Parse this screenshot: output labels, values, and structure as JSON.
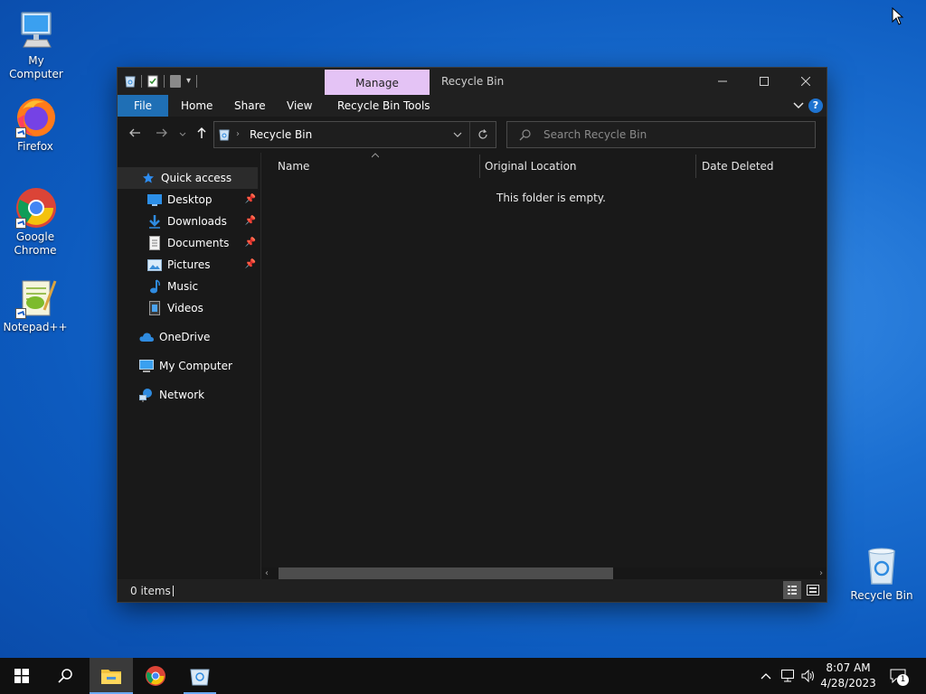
{
  "desktop": {
    "icons": [
      {
        "label": "My Computer"
      },
      {
        "label": "Firefox"
      },
      {
        "label": "Google Chrome"
      },
      {
        "label": "Notepad++"
      },
      {
        "label": "Recycle Bin"
      }
    ]
  },
  "window": {
    "manage_tab": "Manage",
    "title": "Recycle Bin",
    "ribbon": {
      "tabs": [
        "File",
        "Home",
        "Share",
        "View",
        "Recycle Bin Tools"
      ]
    },
    "address": {
      "crumb": "Recycle Bin"
    },
    "search": {
      "placeholder": "Search Recycle Bin"
    },
    "nav": {
      "items": [
        {
          "label": "Quick access"
        },
        {
          "label": "Desktop"
        },
        {
          "label": "Downloads"
        },
        {
          "label": "Documents"
        },
        {
          "label": "Pictures"
        },
        {
          "label": "Music"
        },
        {
          "label": "Videos"
        },
        {
          "label": "OneDrive"
        },
        {
          "label": "My Computer"
        },
        {
          "label": "Network"
        }
      ]
    },
    "columns": [
      "Name",
      "Original Location",
      "Date Deleted"
    ],
    "empty_message": "This folder is empty.",
    "status": {
      "items": "0 items"
    }
  },
  "taskbar": {
    "time": "8:07 AM",
    "date": "4/28/2023",
    "notification_count": "1"
  },
  "colors": {
    "accent": "#1f6fb5",
    "manage_tab": "#e4c3f5",
    "window_bg": "#191919",
    "taskbar_bg": "#101010"
  }
}
